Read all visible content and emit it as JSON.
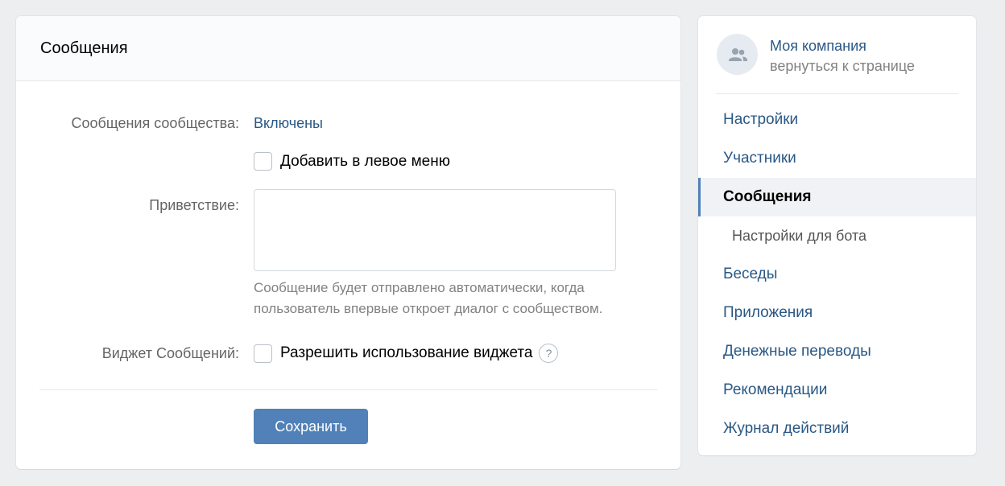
{
  "main": {
    "title": "Сообщения",
    "community_messages_label": "Сообщения сообщества:",
    "community_messages_value": "Включены",
    "add_left_menu_label": "Добавить в левое меню",
    "greeting_label": "Приветствие:",
    "greeting_value": "",
    "greeting_hint": "Сообщение будет отправлено автоматически, когда пользователь впервые откроет диалог с сообществом.",
    "widget_label": "Виджет Сообщений:",
    "widget_checkbox_label": "Разрешить использование виджета",
    "help_glyph": "?",
    "save_label": "Сохранить"
  },
  "sidebar": {
    "company_name": "Моя компания",
    "back_link": "вернуться к странице",
    "avatar_icon": "community-icon",
    "items": [
      {
        "label": "Настройки",
        "state": "normal"
      },
      {
        "label": "Участники",
        "state": "normal"
      },
      {
        "label": "Сообщения",
        "state": "active"
      },
      {
        "label": "Настройки для бота",
        "state": "sub"
      },
      {
        "label": "Беседы",
        "state": "normal"
      },
      {
        "label": "Приложения",
        "state": "normal"
      },
      {
        "label": "Денежные переводы",
        "state": "normal"
      },
      {
        "label": "Рекомендации",
        "state": "normal"
      },
      {
        "label": "Журнал действий",
        "state": "normal"
      }
    ]
  },
  "colors": {
    "accent": "#5181b8",
    "link": "#2a5885",
    "background": "#edeef0"
  }
}
